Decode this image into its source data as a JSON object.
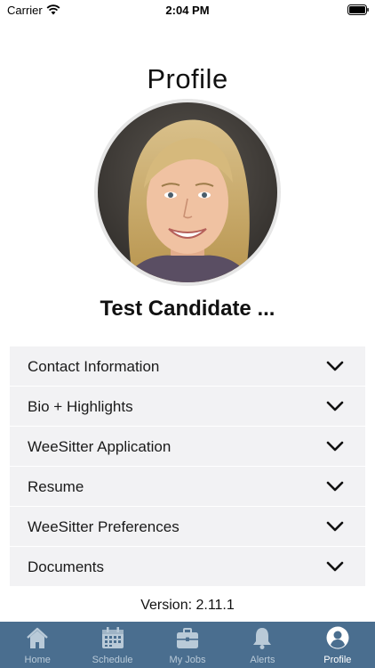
{
  "status_bar": {
    "carrier": "Carrier",
    "time": "2:04 PM",
    "wifi_icon": "wifi-icon",
    "battery_icon": "battery-icon"
  },
  "header": {
    "title": "Profile"
  },
  "profile": {
    "avatar_icon": "avatar-photo",
    "name": "Test Candidate ..."
  },
  "sections": [
    {
      "label": "Contact Information",
      "icon": "chevron-down-icon"
    },
    {
      "label": "Bio + Highlights",
      "icon": "chevron-down-icon"
    },
    {
      "label": "WeeSitter Application",
      "icon": "chevron-down-icon"
    },
    {
      "label": "Resume",
      "icon": "chevron-down-icon"
    },
    {
      "label": "WeeSitter Preferences",
      "icon": "chevron-down-icon"
    },
    {
      "label": "Documents",
      "icon": "chevron-down-icon"
    }
  ],
  "footer": {
    "version": "Version: 2.11.1"
  },
  "tabbar": {
    "items": [
      {
        "label": "Home",
        "icon": "home-icon"
      },
      {
        "label": "Schedule",
        "icon": "calendar-icon"
      },
      {
        "label": "My Jobs",
        "icon": "briefcase-icon"
      },
      {
        "label": "Alerts",
        "icon": "bell-icon"
      },
      {
        "label": "Profile",
        "icon": "user-circle-icon"
      }
    ],
    "active": "Profile"
  },
  "colors": {
    "tabbar_bg": "#4a6e8f",
    "tab_inactive": "#b9cad8",
    "tab_active": "#ffffff",
    "section_bg": "#f2f2f4"
  }
}
